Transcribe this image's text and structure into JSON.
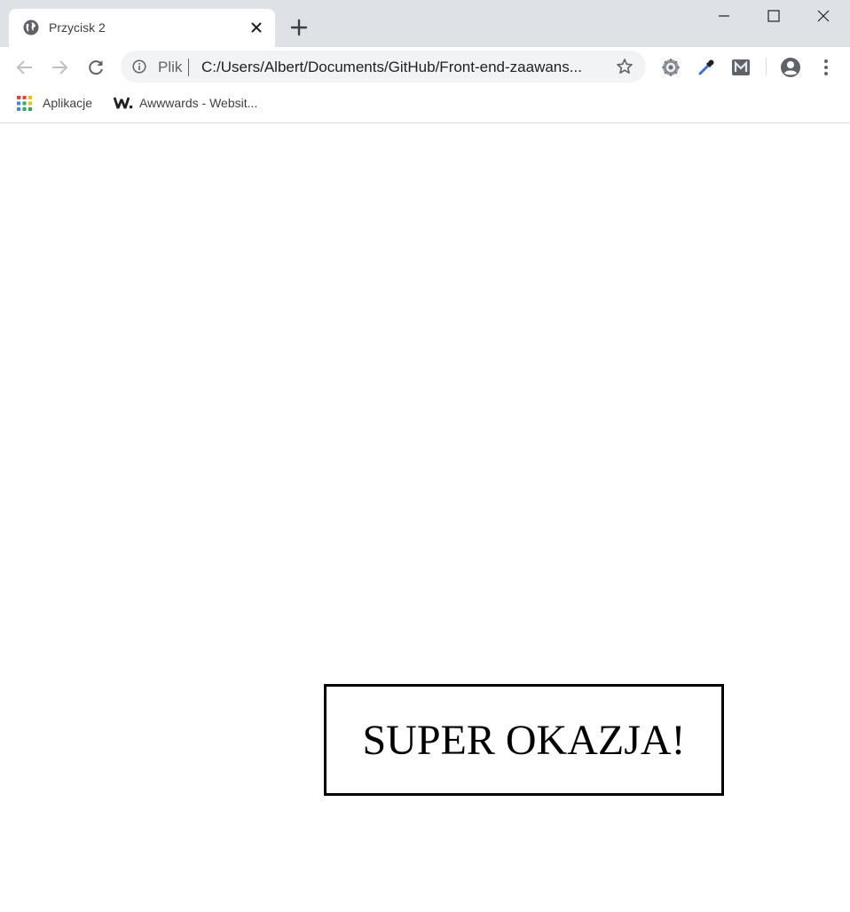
{
  "browser": {
    "tab": {
      "title": "Przycisk 2"
    },
    "address_bar": {
      "scheme_label": "Plik",
      "url": "C:/Users/Albert/Documents/GitHub/Front-end-zaawans..."
    },
    "bookmarks": [
      {
        "label": "Aplikacje",
        "icon": "apps-grid-icon"
      },
      {
        "label": "Awwwards - Websit...",
        "icon": "awwwards-logo-icon"
      }
    ],
    "extensions": [
      "gear-extension-icon",
      "eyedropper-extension-icon",
      "m-extension-icon"
    ]
  },
  "page": {
    "promo_text": "SUPER OKAZJA!"
  },
  "colors": {
    "tabstrip_bg": "#dee1e6",
    "omnibox_bg": "#f1f3f4",
    "promo_border": "#000000"
  }
}
